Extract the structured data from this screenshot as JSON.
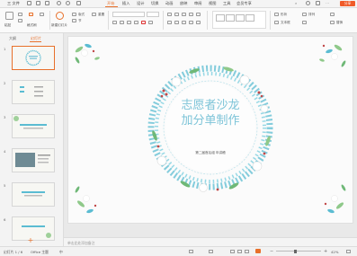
{
  "titlebar": {
    "file_menu": "三 文件",
    "tabs": [
      "开始",
      "插入",
      "设计",
      "切换",
      "动画",
      "放映",
      "审阅",
      "视图",
      "工具",
      "会员专享"
    ],
    "active_tab": "开始",
    "go_button": "分享"
  },
  "ribbon": {
    "labels": {
      "paste": "粘贴",
      "format_painter": "格式刷",
      "new_slide": "新建幻灯片",
      "layout": "版式",
      "section": "节",
      "reset": "重置",
      "shape": "形状",
      "arrange": "排列",
      "text_box": "文本框",
      "replace": "替换"
    }
  },
  "left_panel": {
    "tab_outline": "大纲",
    "tab_slides": "幻灯片",
    "slide_numbers": [
      "1",
      "2",
      "3",
      "4",
      "5",
      "6"
    ],
    "add_slide": "+"
  },
  "slide": {
    "title_line1": "志愿者沙龙",
    "title_line2": "加分单制作",
    "subtitle": "第二届首后组 年讲稿",
    "wreath_color": "#5bbcd2",
    "title_color": "#7dc4d8"
  },
  "note_placeholder": "单击此处添加备注",
  "statusbar": {
    "slide_counter": "幻灯片 1 / 6",
    "theme": "Office 主题",
    "lang_indicator": "中",
    "zoom": "42%"
  },
  "colors": {
    "accent": "#e8702a",
    "go_button": "#f05a28"
  }
}
